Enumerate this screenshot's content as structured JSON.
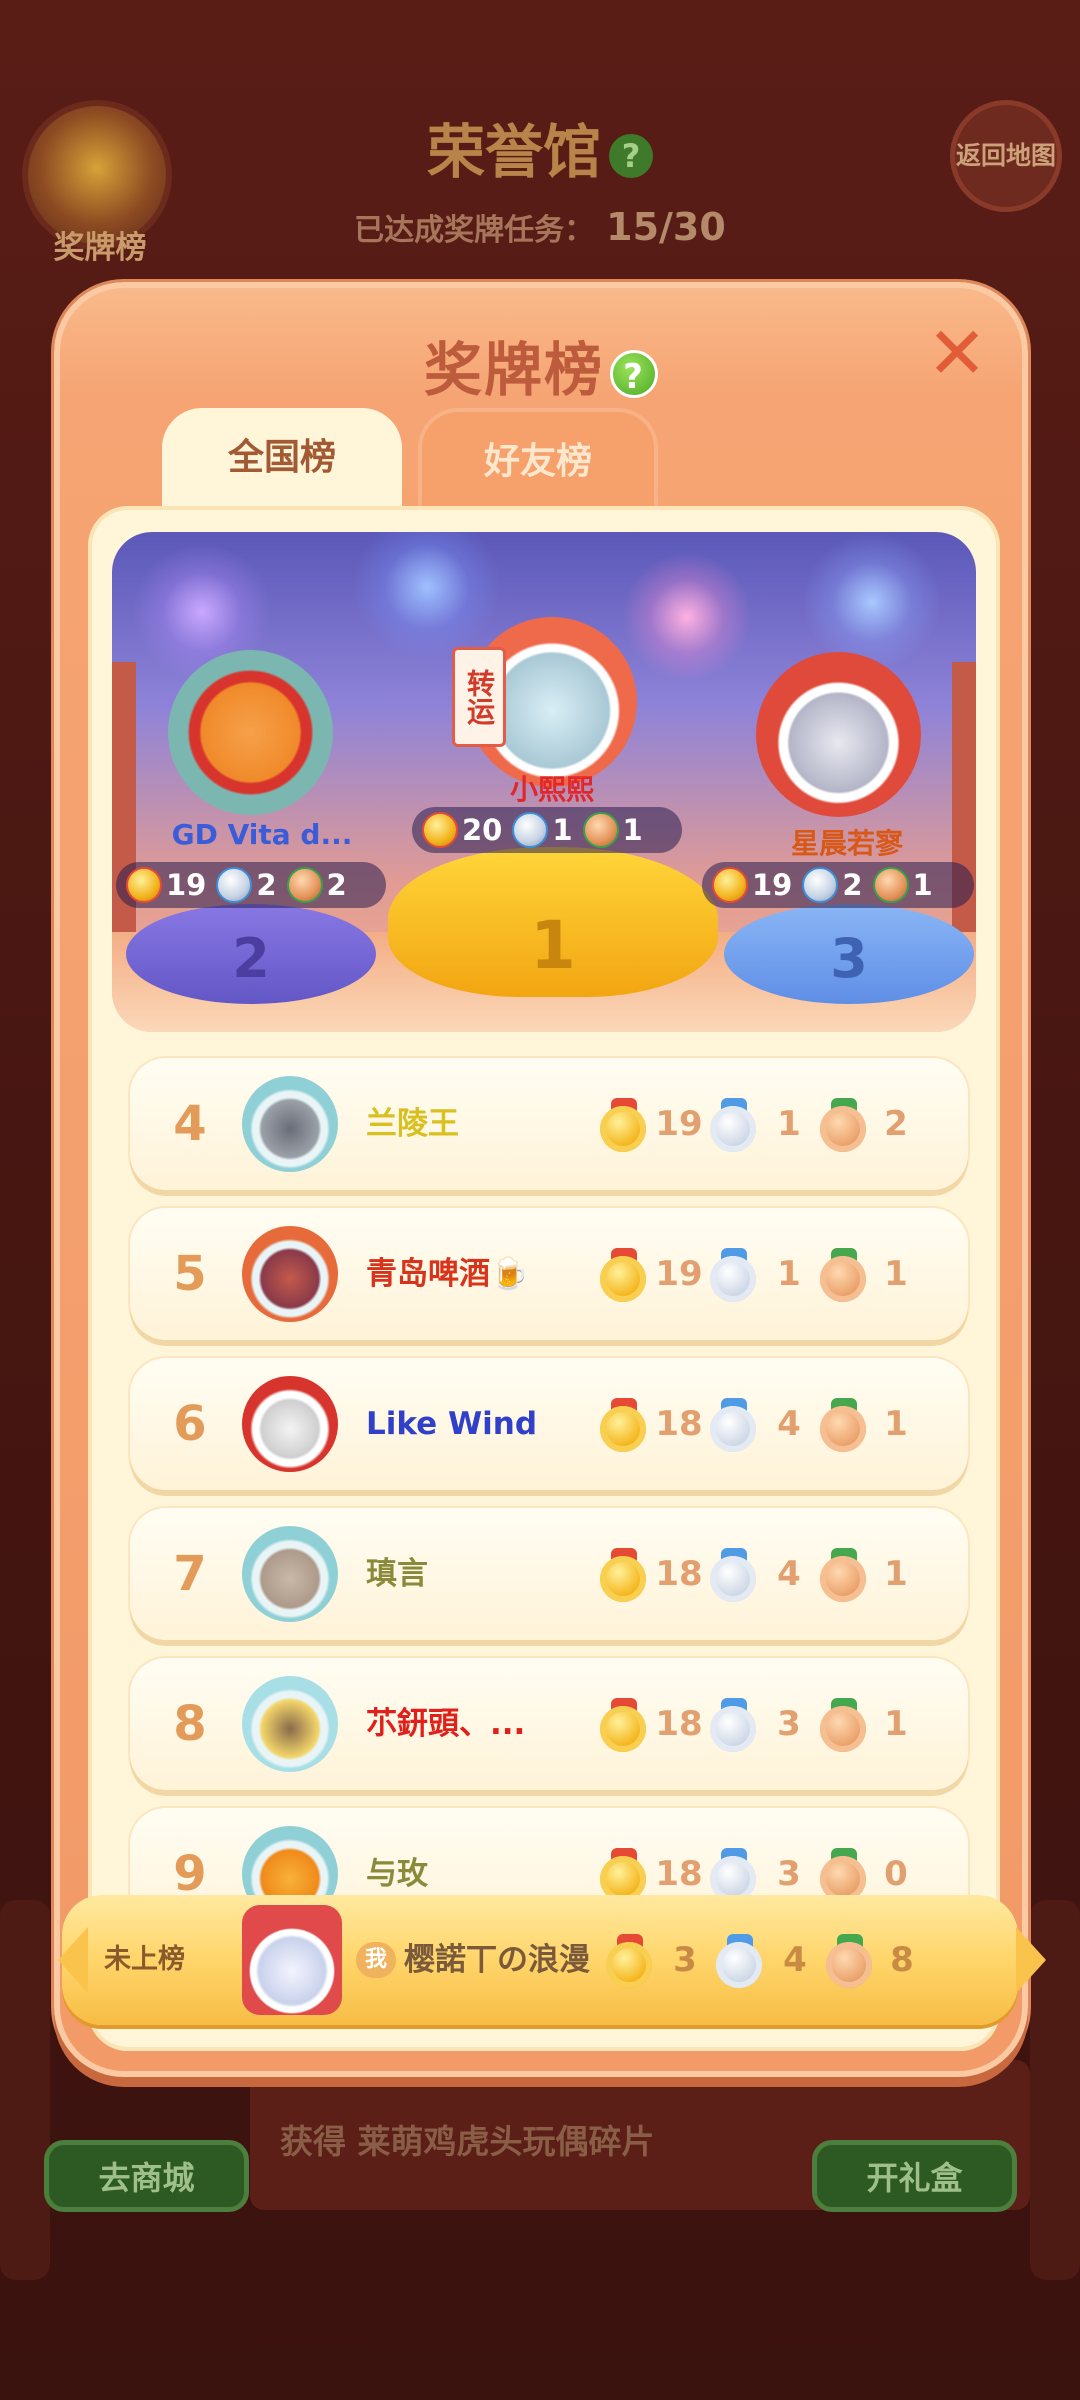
{
  "background": {
    "left_button_label": "奖牌榜",
    "right_button_label": "返回地图",
    "title": "荣誉馆",
    "title_help": "?",
    "progress_label": "已达成奖牌任务：",
    "progress_value": "15/30",
    "reward_text": "获得 莱萌鸡虎头玩偶碎片",
    "shop_button": "去商城",
    "gift_button": "开礼盒"
  },
  "modal": {
    "title": "奖牌榜",
    "help": "?",
    "close": "✕"
  },
  "tabs": [
    {
      "label": "全国榜",
      "active": true
    },
    {
      "label": "好友榜",
      "active": false
    }
  ],
  "podium": {
    "first": {
      "rank": "1",
      "name": "小熙熙",
      "tag": "转运",
      "gold": "20",
      "silver": "1",
      "bronze": "1"
    },
    "second": {
      "rank": "2",
      "name": "GD Vita d...",
      "gold": "19",
      "silver": "2",
      "bronze": "2"
    },
    "third": {
      "rank": "3",
      "name": "星晨若寥",
      "gold": "19",
      "silver": "2",
      "bronze": "1"
    }
  },
  "rankings": [
    {
      "rank": "4",
      "name": "兰陵王",
      "name_color": "#d8c020",
      "gold": "19",
      "silver": "1",
      "bronze": "2"
    },
    {
      "rank": "5",
      "name": "青岛啤酒🍺",
      "name_color": "#d8341c",
      "gold": "19",
      "silver": "1",
      "bronze": "1"
    },
    {
      "rank": "6",
      "name": "Like  Wind",
      "name_color": "#3040c8",
      "gold": "18",
      "silver": "4",
      "bronze": "1"
    },
    {
      "rank": "7",
      "name": "瑱言",
      "name_color": "#8a8a3a",
      "gold": "18",
      "silver": "4",
      "bronze": "1"
    },
    {
      "rank": "8",
      "name": "䒕鈃頭、...",
      "name_color": "#e0201a",
      "gold": "18",
      "silver": "3",
      "bronze": "1"
    },
    {
      "rank": "9",
      "name": "与玫",
      "name_color": "#8a8a3a",
      "gold": "18",
      "silver": "3",
      "bronze": "0"
    }
  ],
  "my_rank": {
    "status": "未上榜",
    "me_badge": "我",
    "name": "樱諾丅の浪漫",
    "gold": "3",
    "silver": "4",
    "bronze": "8"
  }
}
